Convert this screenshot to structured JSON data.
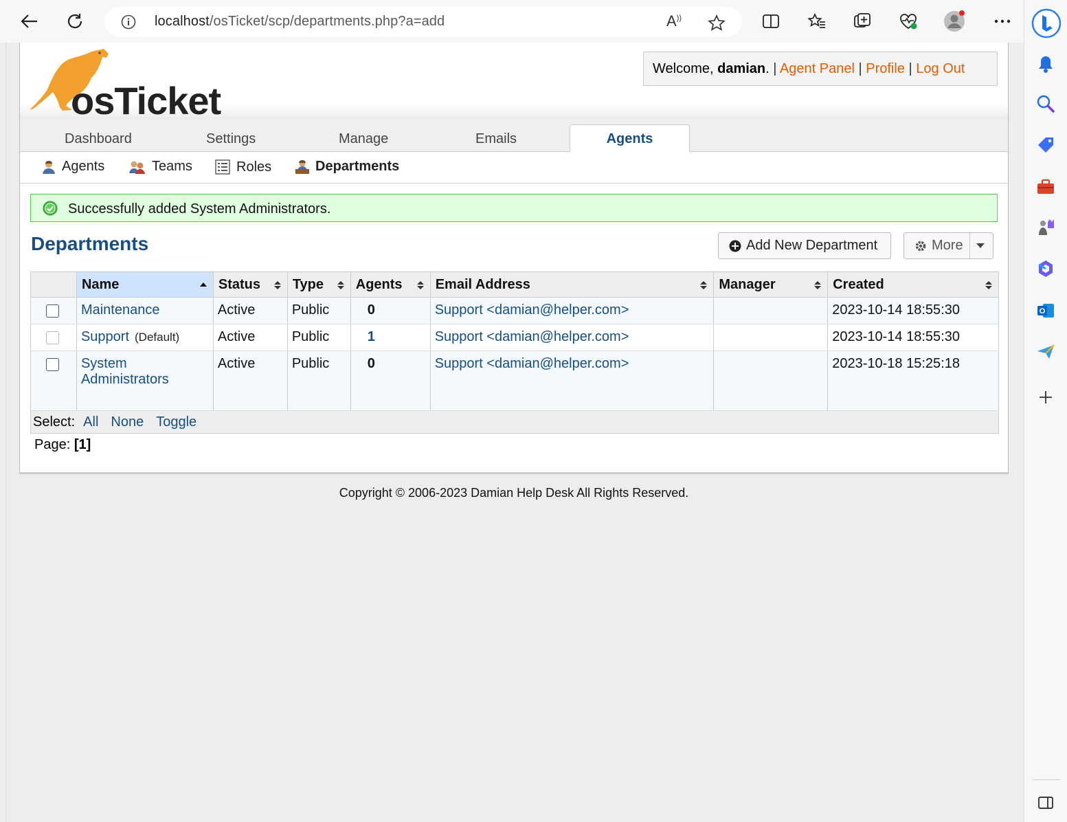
{
  "browser": {
    "url_host": "localhost",
    "url_path": "/osTicket/scp/departments.php?a=add",
    "read_aloud_label": "A",
    "read_aloud_sup": "))"
  },
  "header": {
    "logo_text": "osTicket",
    "welcome_prefix": "Welcome, ",
    "username": "damian",
    "welcome_suffix": ".",
    "sep": "|",
    "links": [
      "Agent Panel",
      "Profile",
      "Log Out"
    ]
  },
  "tabs": [
    {
      "label": "Dashboard"
    },
    {
      "label": "Settings"
    },
    {
      "label": "Manage"
    },
    {
      "label": "Emails"
    },
    {
      "label": "Agents"
    }
  ],
  "subnav": [
    {
      "label": "Agents",
      "icon": "agent-icon"
    },
    {
      "label": "Teams",
      "icon": "teams-icon"
    },
    {
      "label": "Roles",
      "icon": "roles-icon"
    },
    {
      "label": "Departments",
      "icon": "department-icon"
    }
  ],
  "alert": {
    "message": "Successfully added System Administrators."
  },
  "page": {
    "title": "Departments",
    "add_button": "Add New Department",
    "more_button": "More"
  },
  "table": {
    "columns": [
      "Name",
      "Status",
      "Type",
      "Agents",
      "Email Address",
      "Manager",
      "Created"
    ],
    "rows": [
      {
        "name": "Maintenance",
        "default": "",
        "status": "Active",
        "type": "Public",
        "agents": "0",
        "email": "Support <damian@helper.com>",
        "manager": "",
        "created": "2023-10-14 18:55:30"
      },
      {
        "name": "Support",
        "default": "(Default)",
        "status": "Active",
        "type": "Public",
        "agents": "1",
        "email": "Support <damian@helper.com>",
        "manager": "",
        "created": "2023-10-14 18:55:30"
      },
      {
        "name": "System Administrators",
        "default": "",
        "status": "Active",
        "type": "Public",
        "agents": "0",
        "email": "Support <damian@helper.com>",
        "manager": "",
        "created": "2023-10-18 15:25:18"
      }
    ]
  },
  "footer": {
    "select_label": "Select:",
    "select_all": "All",
    "select_none": "None",
    "select_toggle": "Toggle",
    "page_label": "Page:",
    "current_page": "[1]",
    "copyright": "Copyright © 2006-2023 Damian Help Desk All Rights Reserved."
  },
  "colors": {
    "brand_blue": "#184e81",
    "link_orange": "#e65c00",
    "success_bg": "#e0ffe0",
    "success_border": "#4fd24f"
  }
}
